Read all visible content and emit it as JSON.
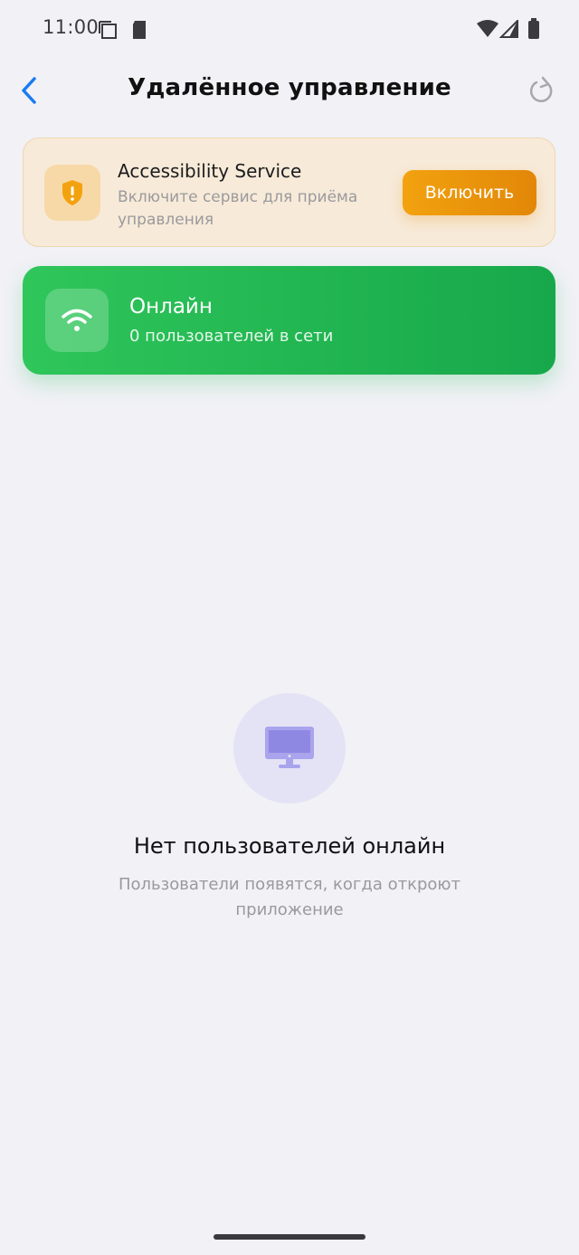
{
  "status_bar": {
    "time": "11:00"
  },
  "header": {
    "title": "Удалённое управление"
  },
  "accessibility_card": {
    "title": "Accessibility Service",
    "subtitle": "Включите сервис для приёма управления",
    "button_label": "Включить",
    "accent": "#f2a20f"
  },
  "online_card": {
    "title": "Онлайн",
    "subtitle": "0 пользователей в сети",
    "accent": "#2fc65a"
  },
  "empty_state": {
    "icon": "monitor-icon",
    "title": "Нет пользователей онлайн",
    "subtitle": "Пользователи появятся, когда откроют приложение"
  }
}
